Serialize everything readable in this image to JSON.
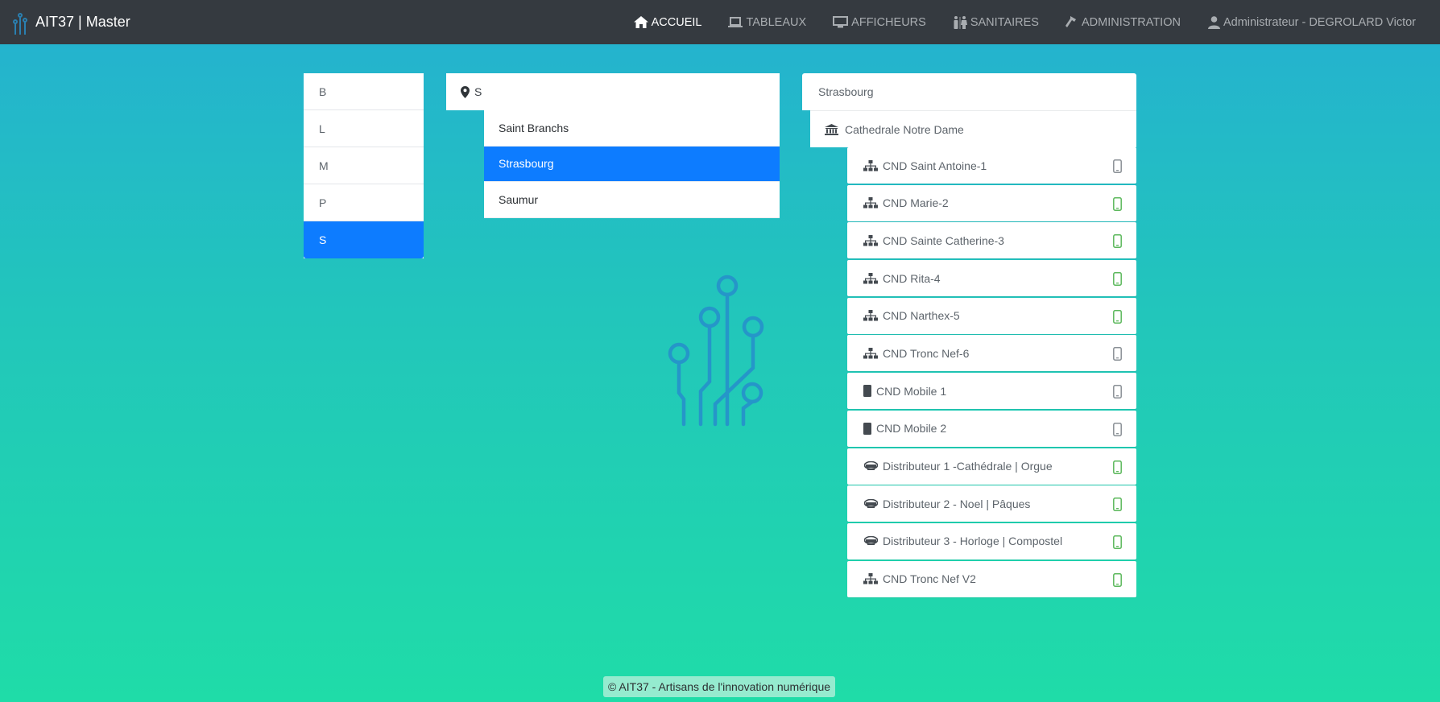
{
  "brand": {
    "title": "AIT37 | Master"
  },
  "nav": {
    "accueil": "ACCUEIL",
    "tableaux": "TABLEAUX",
    "afficheurs": "AFFICHEURS",
    "sanitaires": "SANITAIRES",
    "administration": "ADMINISTRATION",
    "user": "Administrateur - DEGROLARD Victor"
  },
  "letters": [
    "B",
    "L",
    "M",
    "P",
    "S"
  ],
  "search": {
    "value": "S"
  },
  "cities": [
    "Saint Branchs",
    "Strasbourg",
    "Saumur"
  ],
  "tree": {
    "city": "Strasbourg",
    "site": "Cathedrale Notre Dame",
    "devices": [
      {
        "label": "CND Saint Antoine-1",
        "icon": "sitemap-icon",
        "status": "gray"
      },
      {
        "label": "CND Marie-2",
        "icon": "sitemap-icon",
        "status": "green"
      },
      {
        "label": "CND Sainte Catherine-3",
        "icon": "sitemap-icon",
        "status": "green"
      },
      {
        "label": "CND Rita-4",
        "icon": "sitemap-icon",
        "status": "green"
      },
      {
        "label": "CND Narthex-5",
        "icon": "sitemap-icon",
        "status": "green"
      },
      {
        "label": "CND Tronc Nef-6",
        "icon": "sitemap-icon",
        "status": "gray"
      },
      {
        "label": "CND Mobile 1",
        "icon": "mobile-device-icon",
        "status": "gray"
      },
      {
        "label": "CND Mobile 2",
        "icon": "mobile-device-icon",
        "status": "gray"
      },
      {
        "label": "Distributeur 1 -Cathédrale | Orgue",
        "icon": "distributor-icon",
        "status": "green"
      },
      {
        "label": "Distributeur 2 - Noel | Pâques",
        "icon": "distributor-icon",
        "status": "green"
      },
      {
        "label": "Distributeur 3 - Horloge | Compostel",
        "icon": "distributor-icon",
        "status": "green"
      },
      {
        "label": "CND Tronc Nef V2",
        "icon": "sitemap-icon",
        "status": "green"
      }
    ]
  },
  "footer": {
    "text": "© AIT37 - Artisans de l'innovation numérique"
  },
  "colors": {
    "navbar": "#353a40",
    "accent": "#0d7cff",
    "status_green": "#5cb85c",
    "status_gray": "#8a9096"
  }
}
